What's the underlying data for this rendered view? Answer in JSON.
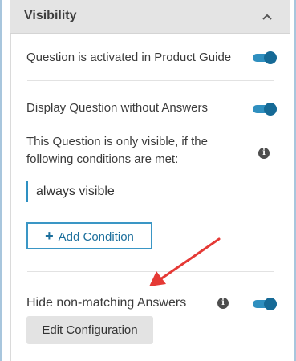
{
  "panel": {
    "title": "Visibility",
    "collapse_icon": "chevron-up-icon"
  },
  "rows": {
    "activated_label": "Question is activated in Product Guide",
    "activated_on": true,
    "display_without_answers_label": "Display Question without Answers",
    "display_without_answers_on": true,
    "visibility_note": "This Question is only visible, if the following conditions are met:",
    "condition_value": "always visible",
    "add_condition_label": "Add Condition",
    "hide_nonmatching_label": "Hide non-matching Answers",
    "hide_nonmatching_on": true,
    "edit_config_label": "Edit Configuration"
  },
  "colors": {
    "accent": "#2f8fbf",
    "accent_dark": "#166a96",
    "annotation_arrow": "#e53935",
    "header_bg": "#e4e4e4"
  },
  "annotation": {
    "icon": "red-arrow"
  }
}
